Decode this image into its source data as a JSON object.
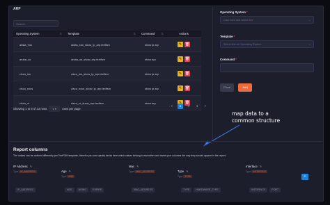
{
  "panel_title": "ARP",
  "search_placeholder": "Search",
  "table": {
    "headers": [
      "Operating System",
      "Template",
      "Command",
      "Actions"
    ],
    "rows": [
      {
        "os": "arista_eos",
        "template": "arista_eos_show_ip_arp.textfsm",
        "command": "show ip arp"
      },
      {
        "os": "aruba_os",
        "template": "aruba_os_show_arp.textfsm",
        "command": "show arp"
      },
      {
        "os": "cisco_ios",
        "template": "cisco_ios_show_ip_arp.textfsm",
        "command": "show ip arp"
      },
      {
        "os": "cisco_nxos",
        "template": "cisco_nxos_show_ip_arp.textfsm",
        "command": "show ip arp"
      },
      {
        "os": "cisco_xr",
        "template": "cisco_xr_show_arp.textfsm",
        "command": "show arp"
      }
    ]
  },
  "footer": {
    "showing": "Showing 1 to 5 of 13 rows",
    "rows_per_page": "rows per page",
    "page_size": "5",
    "pages": [
      "<",
      "1",
      "2",
      "3",
      ">"
    ],
    "active_page": "1"
  },
  "form": {
    "os_label": "Operating System",
    "os_placeholder": "Click here and select one",
    "template_label": "Template",
    "template_placeholder": "Select first an Operating System",
    "command_label": "Command",
    "close_label": "Close",
    "add_label": "Add"
  },
  "annotation": {
    "line1": "map data to a",
    "line2": "common structure"
  },
  "report": {
    "title": "Report columns",
    "subtitle": "The values can be ordered differently per TextFSM template, therefor you can specify below here which values belong to eachother and name your columns the way they should appear in the report.",
    "columns": [
      {
        "name": "IP Address",
        "type": "Type",
        "type_value": "IP_ADDRESS",
        "chips": [
          "IP_ADDRESS"
        ]
      },
      {
        "name": "Age",
        "type": "Type",
        "type_value": "AGE",
        "chips": [
          "AGE",
          "AGING",
          "EXPIRE"
        ]
      },
      {
        "name": "Mac",
        "type": "Type",
        "type_value": "MAC_ADDRESS",
        "chips": [
          "MAC_ADDRESS"
        ]
      },
      {
        "name": "Type",
        "type": "Type",
        "type_value": "TYPE",
        "chips": [
          "TYPE",
          "HARDWARE_TYPE"
        ]
      },
      {
        "name": "Interface",
        "type": "Type",
        "type_value": "INTERFACE",
        "chips": [
          "INTERFACE",
          "PORT"
        ]
      }
    ]
  },
  "colors": {
    "accent_blue": "#1d84d9",
    "edit_yellow": "#e8b21c",
    "delete_red": "#e0444f",
    "add_orange": "#ee6a3b"
  }
}
